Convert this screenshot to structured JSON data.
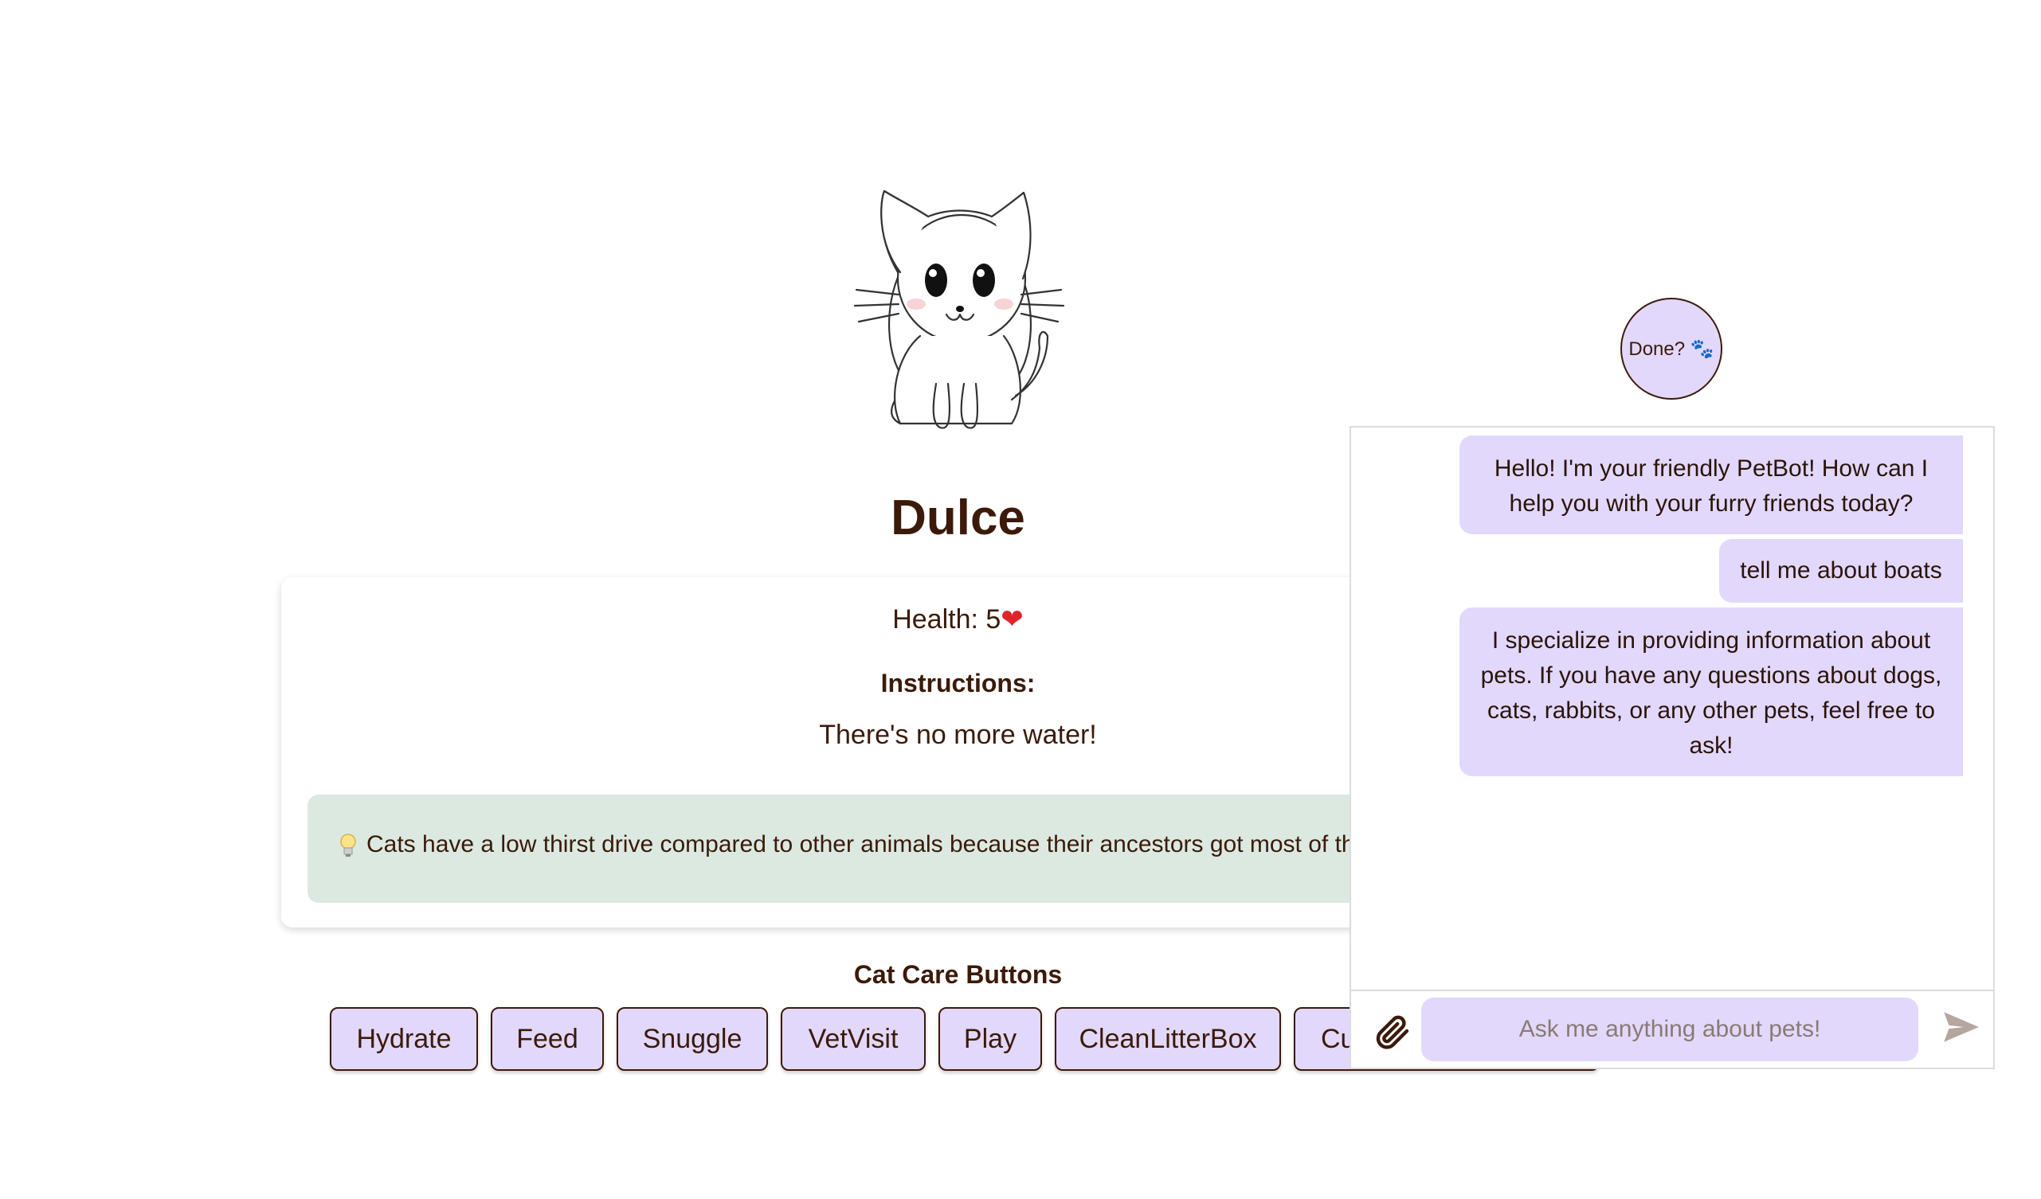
{
  "pet": {
    "name": "Dulce",
    "health_label": "Health: 5",
    "health_icon": "heart-icon"
  },
  "instructions": {
    "title": "Instructions:",
    "text": "There's no more water!"
  },
  "fact": {
    "icon": "lightbulb-icon",
    "text": "Cats have a low thirst drive compared to other animals because their ancestors got most of their water from prey"
  },
  "care": {
    "title": "Cat Care Buttons",
    "buttons": [
      "Hydrate",
      "Feed",
      "Snuggle",
      "VetVisit",
      "Play",
      "CleanLitterBox",
      "Cuddle"
    ]
  },
  "done": {
    "label": "Done? 🐾"
  },
  "chat": {
    "messages": [
      {
        "text": "Hello! I'm your friendly PetBot! How can I help you with your furry friends today?"
      },
      {
        "text": "tell me about boats"
      },
      {
        "text": "I specialize in providing information about pets. If you have any questions about dogs, cats, rabbits, or any other pets, feel free to ask!"
      }
    ],
    "input_placeholder": "Ask me anything about pets!"
  },
  "colors": {
    "accent": "#e2d8fc",
    "text": "#3b1a0a",
    "fact_bg": "#dbe9e1",
    "heart": "#e0242b"
  }
}
